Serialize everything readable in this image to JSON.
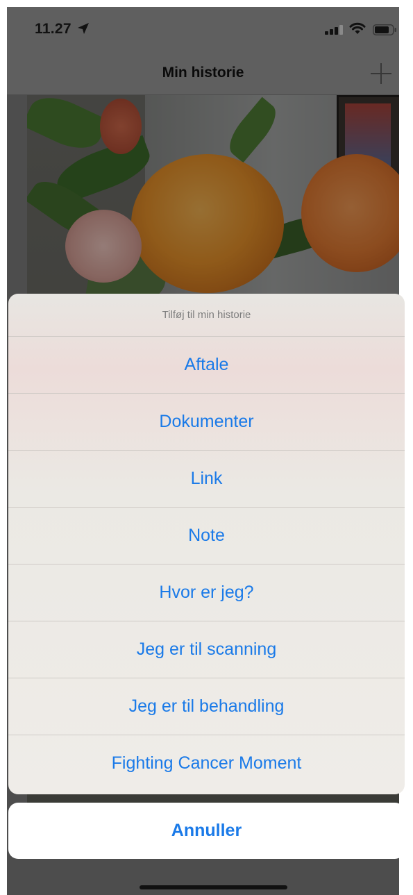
{
  "status_bar": {
    "time": "11.27",
    "icons": [
      "location-arrow-icon",
      "signal-icon",
      "wifi-icon",
      "battery-icon"
    ]
  },
  "nav": {
    "title": "Min historie",
    "add_icon": "plus-icon"
  },
  "action_sheet": {
    "title": "Tilføj til min historie",
    "items": [
      "Aftale",
      "Dokumenter",
      "Link",
      "Note",
      "Hvor er jeg?",
      "Jeg er til scanning",
      "Jeg er til behandling",
      "Fighting Cancer Moment"
    ],
    "cancel_label": "Annuller"
  },
  "colors": {
    "accent": "#1a7ae8",
    "sheet_title": "#7d7d7d"
  }
}
